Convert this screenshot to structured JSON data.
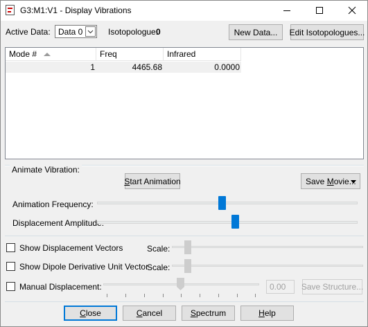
{
  "window": {
    "title": "G3:M1:V1 - Display Vibrations",
    "minimize": "minimize",
    "maximize": "maximize",
    "close": "close"
  },
  "header": {
    "active_data_label": "Active Data:",
    "active_data_value": "Data 0",
    "isotopologue_label": "Isotopologue:",
    "isotopologue_value": "0",
    "new_data_button": "New Data...",
    "edit_isotopologues_button": "Edit Isotopologues..."
  },
  "table": {
    "columns": [
      "Mode #",
      "Freq",
      "Infrared"
    ],
    "rows": [
      {
        "mode": "1",
        "freq": "4465.68",
        "infrared": "0.0000"
      }
    ]
  },
  "animate": {
    "group_label": "Animate Vibration:",
    "start_button_prefix": "S",
    "start_button_rest": "tart Animation",
    "save_movie_prefix": "Save ",
    "save_movie_underline": "M",
    "save_movie_rest": "ovie...",
    "frequency_label": "Animation Frequency:",
    "frequency_level": 0.48,
    "amplitude_label": "Displacement Amplitude:",
    "amplitude_level": 0.53
  },
  "options": {
    "show_vectors_label": "Show Displacement Vectors",
    "show_vectors_checked": false,
    "show_dipole_label": "Show Dipole Derivative Unit Vector",
    "show_dipole_checked": false,
    "scale_label": "Scale:",
    "manual_label": "Manual Displacement:",
    "manual_checked": false,
    "manual_value": "0.00",
    "save_structure_button": "Save Structure..."
  },
  "footer": {
    "close_underline": "C",
    "close_rest": "lose",
    "cancel_underline": "C",
    "cancel_rest": "ancel",
    "spectrum_underline": "S",
    "spectrum_rest": "pectrum",
    "help_underline": "H",
    "help_rest": "elp"
  }
}
